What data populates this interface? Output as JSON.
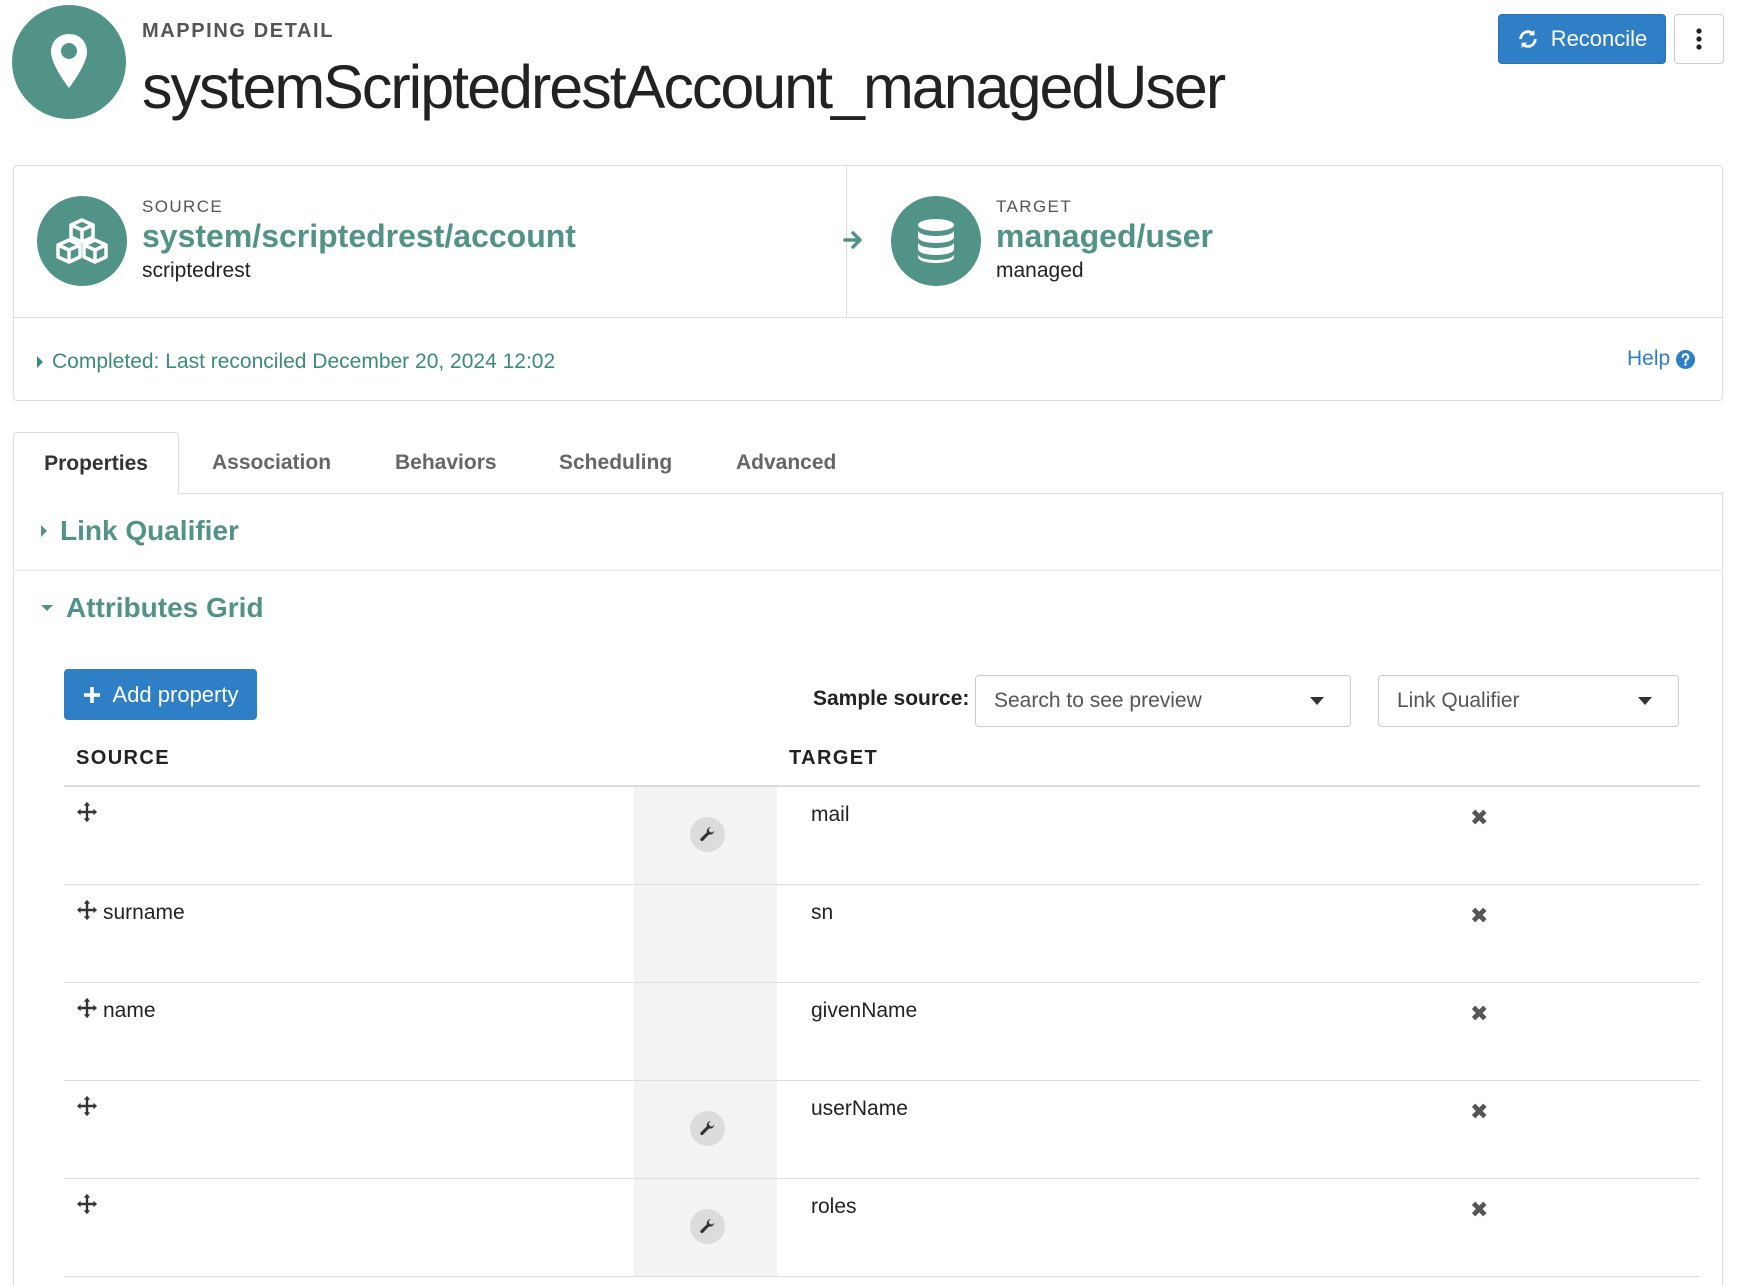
{
  "header": {
    "kicker": "MAPPING DETAIL",
    "title": "systemScriptedrestAccount_managedUser",
    "icon": "map-marker-icon",
    "reconcile_label": "Reconcile"
  },
  "source": {
    "kicker": "SOURCE",
    "name": "system/scriptedrest/account",
    "type": "scriptedrest",
    "icon": "cubes-icon"
  },
  "target": {
    "kicker": "TARGET",
    "name": "managed/user",
    "type": "managed",
    "icon": "database-icon"
  },
  "status": {
    "text": "Completed: Last reconciled December 20, 2024 12:02",
    "help_label": "Help"
  },
  "tabs": [
    {
      "label": "Properties",
      "active": true
    },
    {
      "label": "Association",
      "active": false
    },
    {
      "label": "Behaviors",
      "active": false
    },
    {
      "label": "Scheduling",
      "active": false
    },
    {
      "label": "Advanced",
      "active": false
    }
  ],
  "sections": {
    "link_qualifier": "Link Qualifier",
    "attributes_grid": "Attributes Grid"
  },
  "grid": {
    "add_property_label": "Add property",
    "sample_source_label": "Sample source:",
    "sample_source_placeholder": "Search to see preview",
    "link_qualifier_select": "Link Qualifier",
    "col_source": "SOURCE",
    "col_target": "TARGET",
    "rows": [
      {
        "source": "",
        "target": "mail",
        "has_transform": true
      },
      {
        "source": "surname",
        "target": "sn",
        "has_transform": false
      },
      {
        "source": "name",
        "target": "givenName",
        "has_transform": false
      },
      {
        "source": "",
        "target": "userName",
        "has_transform": true
      },
      {
        "source": "",
        "target": "roles",
        "has_transform": true
      }
    ]
  },
  "colors": {
    "teal": "#519387",
    "blue": "#2f7fc7"
  }
}
